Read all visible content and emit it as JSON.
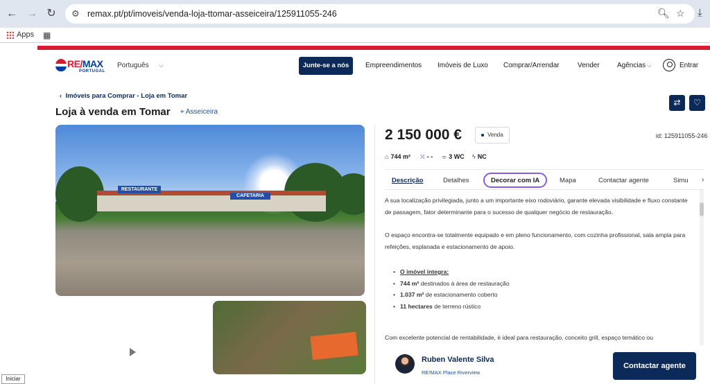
{
  "browser": {
    "url": "remax.pt/pt/imoveis/venda-loja-ttomar-asseiceira/125911055-246",
    "bookmarks": [
      {
        "label": "Apps"
      }
    ]
  },
  "header": {
    "logo_text_re": "RE/",
    "logo_text_max": "MAX",
    "logo_sub": "PORTUGAL",
    "language": "Português",
    "join_button": "Junte-se a nós",
    "nav": [
      "Empreendimentos",
      "Imóveis de Luxo",
      "Comprar/Arrendar",
      "Vender",
      "Agências"
    ],
    "login": "Entrar",
    "brand_colors": {
      "red": "#dc1c2e",
      "navy": "#0b2a5a",
      "blue": "#003da5"
    }
  },
  "listing": {
    "breadcrumb": "Imóveis para Comprar - Loja em Tomar",
    "title": "Loja à venda em Tomar",
    "location": "Asseiceira",
    "photo_sign_1": "RESTAURANTE",
    "photo_sign_2": "CAFETARIA",
    "price": "2 150 000 €",
    "status": "Venda",
    "id": "id: 125911055-246",
    "features": {
      "area": "744 m²",
      "beds": "- -",
      "wc": "3 WC",
      "energy": "NC"
    },
    "tabs": [
      "Descrição",
      "Detalhes",
      "Decorar com IA",
      "Mapa",
      "Contactar agente",
      "Simu"
    ],
    "description": {
      "p1": "A sua localização privilegiada, junto a um importante eixo rodoviário, garante elevada visibilidade e fluxo constante de passagem, fator determinante para o sucesso de qualquer negócio de restauração.",
      "p2": "O espaço encontra-se totalmente equipado e em pleno funcionamento, com cozinha profissional, sala ampla para refeições, esplanada e estacionamento de apoio.",
      "list_title": "O imóvel integra:",
      "items": [
        {
          "bold": "744 m²",
          "text": " destinados à área de restauração"
        },
        {
          "bold": "1.037 m²",
          "text": " de estacionamento coberto"
        },
        {
          "bold": "11 hectares",
          "text": " de terreno rústico"
        }
      ],
      "p3": "Com excelente potencial de rentabilidade, é ideal para restauração, conceito grill, espaço temático ou"
    }
  },
  "agent": {
    "name": "Ruben Valente Silva",
    "office": "RE/MAX Place Riverview",
    "contact_button": "Contactar agente"
  },
  "taskbar": {
    "start": "Iniciar"
  }
}
